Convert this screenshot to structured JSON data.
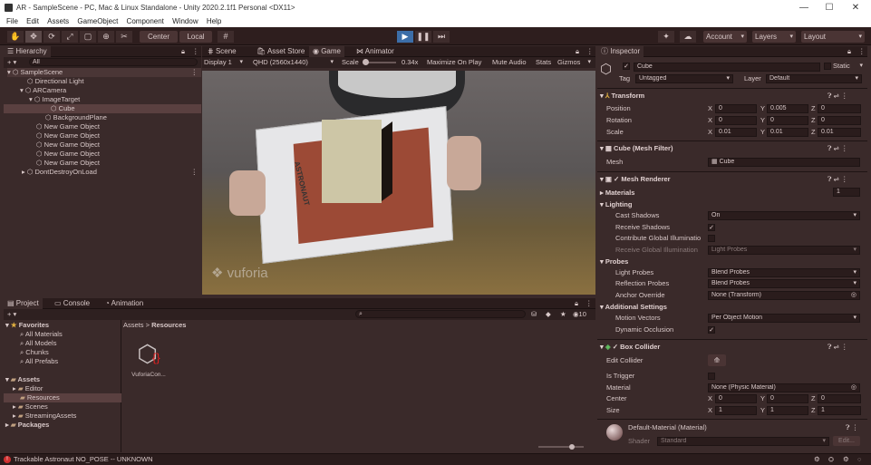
{
  "window": {
    "title": "AR - SampleScene - PC, Mac & Linux Standalone - Unity 2020.2.1f1 Personal <DX11>"
  },
  "menu": [
    "File",
    "Edit",
    "Assets",
    "GameObject",
    "Component",
    "Window",
    "Help"
  ],
  "toolbar": {
    "center_label": "Center",
    "local_label": "Local",
    "account_label": "Account",
    "layers_label": "Layers",
    "layout_label": "Layout"
  },
  "hierarchy": {
    "tab": "Hierarchy",
    "search_placeholder": "All",
    "items": [
      {
        "label": "SampleScene"
      },
      {
        "label": "Directional Light"
      },
      {
        "label": "ARCamera"
      },
      {
        "label": "ImageTarget"
      },
      {
        "label": "Cube"
      },
      {
        "label": "BackgroundPlane"
      },
      {
        "label": "New Game Object"
      },
      {
        "label": "New Game Object"
      },
      {
        "label": "New Game Object"
      },
      {
        "label": "New Game Object"
      },
      {
        "label": "New Game Object"
      },
      {
        "label": "DontDestroyOnLoad"
      }
    ]
  },
  "view": {
    "tabs": [
      "Scene",
      "Asset Store",
      "Game",
      "Animator"
    ],
    "display": "Display 1",
    "resolution": "QHD (2560x1440)",
    "scale_label": "Scale",
    "scale_value": "0.34x",
    "scale_level": 0.05,
    "options": [
      "Maximize On Play",
      "Mute Audio",
      "Stats",
      "Gizmos"
    ],
    "watermark": "vuforia",
    "book_text": "ASTRONAUT"
  },
  "project": {
    "tabs": [
      "Project",
      "Console",
      "Animation"
    ],
    "count": "10",
    "favorites_label": "Favorites",
    "favorites": [
      "All Materials",
      "All Models",
      "Chunks",
      "All Prefabs"
    ],
    "assets_label": "Assets",
    "assets": [
      "Editor",
      "Resources",
      "Scenes",
      "StreamingAssets"
    ],
    "packages_label": "Packages",
    "breadcrumb": [
      "Assets",
      "Resources"
    ],
    "file": "VuforiaCon..."
  },
  "inspector": {
    "tab": "Inspector",
    "name": "Cube",
    "static_label": "Static",
    "tag_label": "Tag",
    "tag_value": "Untagged",
    "layer_label": "Layer",
    "layer_value": "Default",
    "transform": {
      "title": "Transform",
      "rows": [
        {
          "label": "Position",
          "x": "0",
          "y": "0.005",
          "z": "0"
        },
        {
          "label": "Rotation",
          "x": "0",
          "y": "0",
          "z": "0"
        },
        {
          "label": "Scale",
          "x": "0.01",
          "y": "0.01",
          "z": "0.01"
        }
      ]
    },
    "mesh_filter": {
      "title": "Cube (Mesh Filter)",
      "mesh_label": "Mesh",
      "mesh_value": "Cube"
    },
    "mesh_renderer": {
      "title": "Mesh Renderer",
      "materials_label": "Materials",
      "materials_count": "1",
      "lighting_label": "Lighting",
      "cast_shadows_label": "Cast Shadows",
      "cast_shadows_value": "On",
      "receive_shadows_label": "Receive Shadows",
      "contribute_gi_label": "Contribute Global Illuminatio",
      "receive_gi_label": "Receive Global Illumination",
      "receive_gi_value": "Light Probes",
      "probes_label": "Probes",
      "light_probes_label": "Light Probes",
      "light_probes_value": "Blend Probes",
      "reflection_probes_label": "Reflection Probes",
      "reflection_probes_value": "Blend Probes",
      "anchor_label": "Anchor Override",
      "anchor_value": "None (Transform)",
      "additional_label": "Additional Settings",
      "motion_vectors_label": "Motion Vectors",
      "motion_vectors_value": "Per Object Motion",
      "dynamic_occlusion_label": "Dynamic Occlusion"
    },
    "box_collider": {
      "title": "Box Collider",
      "edit_collider_label": "Edit Collider",
      "is_trigger_label": "Is Trigger",
      "material_label": "Material",
      "material_value": "None (Physic Material)",
      "center_label": "Center",
      "center": {
        "x": "0",
        "y": "0",
        "z": "0"
      },
      "size_label": "Size",
      "size": {
        "x": "1",
        "y": "1",
        "z": "1"
      }
    },
    "material": {
      "title": "Default-Material (Material)",
      "shader_label": "Shader",
      "shader_value": "Standard",
      "edit_label": "Edit..."
    }
  },
  "status": {
    "text": "Trackable Astronaut NO_POSE -- UNKNOWN"
  },
  "colors": {
    "editor_bg": "#3a2a2a",
    "selection": "#5a4040",
    "play_active": "#3c6ea8"
  }
}
